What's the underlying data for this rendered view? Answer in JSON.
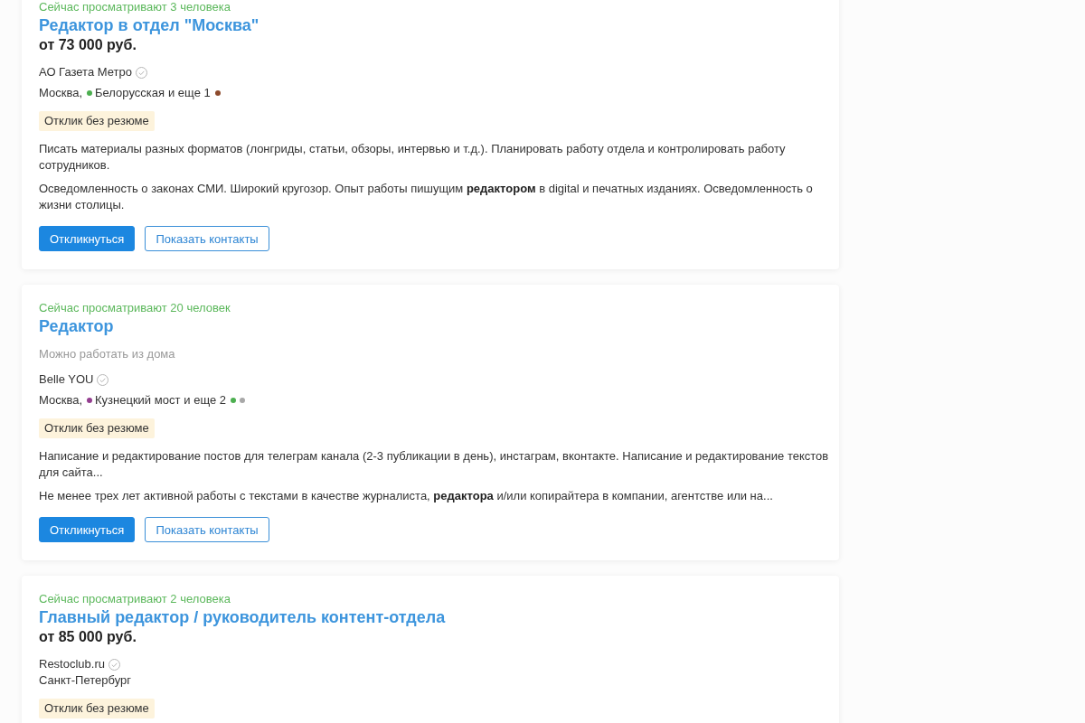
{
  "vacancies": [
    {
      "viewers": "Сейчас просматривают 3 человека",
      "title": "Редактор в отдел \"Москва\"",
      "salary": "от 73 000 руб.",
      "company": "АО Газета Метро",
      "verified": true,
      "city": "Москва,",
      "metro": {
        "station": "Белорусская",
        "color": "#4caf50"
      },
      "more": "и еще 1",
      "extra_stations": [
        {
          "color": "#8d4a2c"
        }
      ],
      "badge": "Отклик без резюме",
      "description": [
        "Писать материалы разных форматов (лонгриды, статьи, обзоры, интервью и т.д.). Планировать работу отдела и контролировать работу сотрудников.",
        "Осведомленность о законах СМИ. Широкий кругозор. Опыт работы пишущим **редактором** в digital и печатных изданиях. Осведомленность о жизни столицы."
      ],
      "buttons": [
        {
          "label": "Откликнуться",
          "kind": "primary"
        },
        {
          "label": "Показать контакты",
          "kind": "outline"
        }
      ]
    },
    {
      "viewers": "Сейчас просматривают 20 человек",
      "title": "Редактор",
      "remote": "Можно работать из дома",
      "company": "Belle YOU",
      "verified": true,
      "city": "Москва,",
      "metro": {
        "station": "Кузнецкий мост",
        "color": "#943e90"
      },
      "more": "и еще 2",
      "extra_stations": [
        {
          "color": "#4caf50"
        },
        {
          "color": "#a8a8a8"
        }
      ],
      "badge": "Отклик без резюме",
      "description": [
        "Написание и редактирование постов для телеграм канала (2-3 публикации в день), инстаграм, вконтакте. Написание и редактирование текстов для сайта...",
        "Не менее трех лет активной работы с текстами в качестве журналиста, **редактора** и/или копирайтера в компании, агентстве или на..."
      ],
      "buttons": [
        {
          "label": "Откликнуться",
          "kind": "primary"
        },
        {
          "label": "Показать контакты",
          "kind": "outline"
        }
      ]
    },
    {
      "viewers": "Сейчас просматривают 2 человека",
      "title": "Главный редактор / руководитель контент-отдела",
      "salary": "от 85 000 руб.",
      "company": "Restoclub.ru",
      "verified": true,
      "city": "Санкт-Петербург",
      "badge": "Отклик без резюме"
    }
  ]
}
